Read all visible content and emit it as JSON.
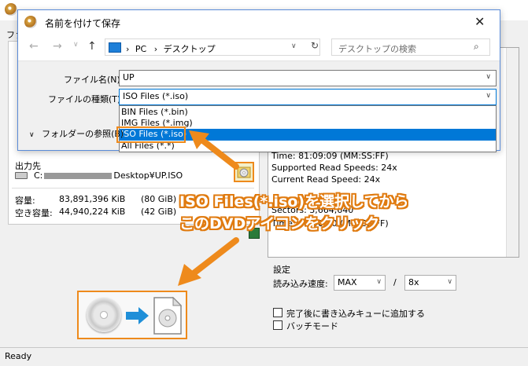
{
  "background_app": {
    "menu_partial": "ファ",
    "output": {
      "label": "出力先",
      "path_start": "C:",
      "path_end": "Desktop¥UP.ISO"
    },
    "capacity": {
      "total_label": "容量:",
      "total_value": "83,891,396 KiB",
      "total_gb": "(80 GiB)",
      "free_label": "空き容量:",
      "free_value": "44,940,224 KiB",
      "free_gb": "(42 GiB)"
    },
    "disc_info": [
      "Time: 81:09:09 (MM:SS:FF)",
      "Supported Read Speeds: 24x",
      "Current Read Speed: 24x",
      "Sectors: 3,664,640",
      "Time: 08:56:40 (MM:SS:FF)"
    ],
    "settings": {
      "label": "設定",
      "read_speed_label": "読み込み速度:",
      "read_speed_value": "MAX",
      "separator": "/",
      "speed_value": "8x",
      "option_queue": "完了後に書き込みキューに追加する",
      "option_batch": "バッチモード"
    },
    "status": "Ready"
  },
  "dialog": {
    "title": "名前を付けて保存",
    "address": {
      "pc": "PC",
      "sep": "›",
      "folder": "デスクトップ"
    },
    "search_placeholder": "デスクトップの検索",
    "filename_label": "ファイル名(N):",
    "filename_value": "UP",
    "filetype_label": "ファイルの種類(T):",
    "filetype_value": "ISO Files (*.iso)",
    "filetype_options": [
      "BIN Files (*.bin)",
      "IMG Files (*.img)",
      "ISO Files (*.iso)",
      "All Files (*.*)"
    ],
    "selected_option_index": 2,
    "browse_folders": "フォルダーの参照(B)"
  },
  "annotations": {
    "callout_line1": "ISO Files(*.iso)を選択してから",
    "callout_line2": "このDVDアイコンをクリック"
  },
  "colors": {
    "accent_orange": "#ee8a1c",
    "selection_blue": "#0078d7"
  },
  "icons": {
    "close": "close-icon",
    "back": "arrow-left-icon",
    "forward": "arrow-right-icon",
    "up": "arrow-up-icon",
    "refresh": "refresh-icon",
    "search": "search-icon",
    "dvd_browse": "dvd-folder-icon",
    "disc": "disc-icon",
    "file": "file-icon"
  }
}
